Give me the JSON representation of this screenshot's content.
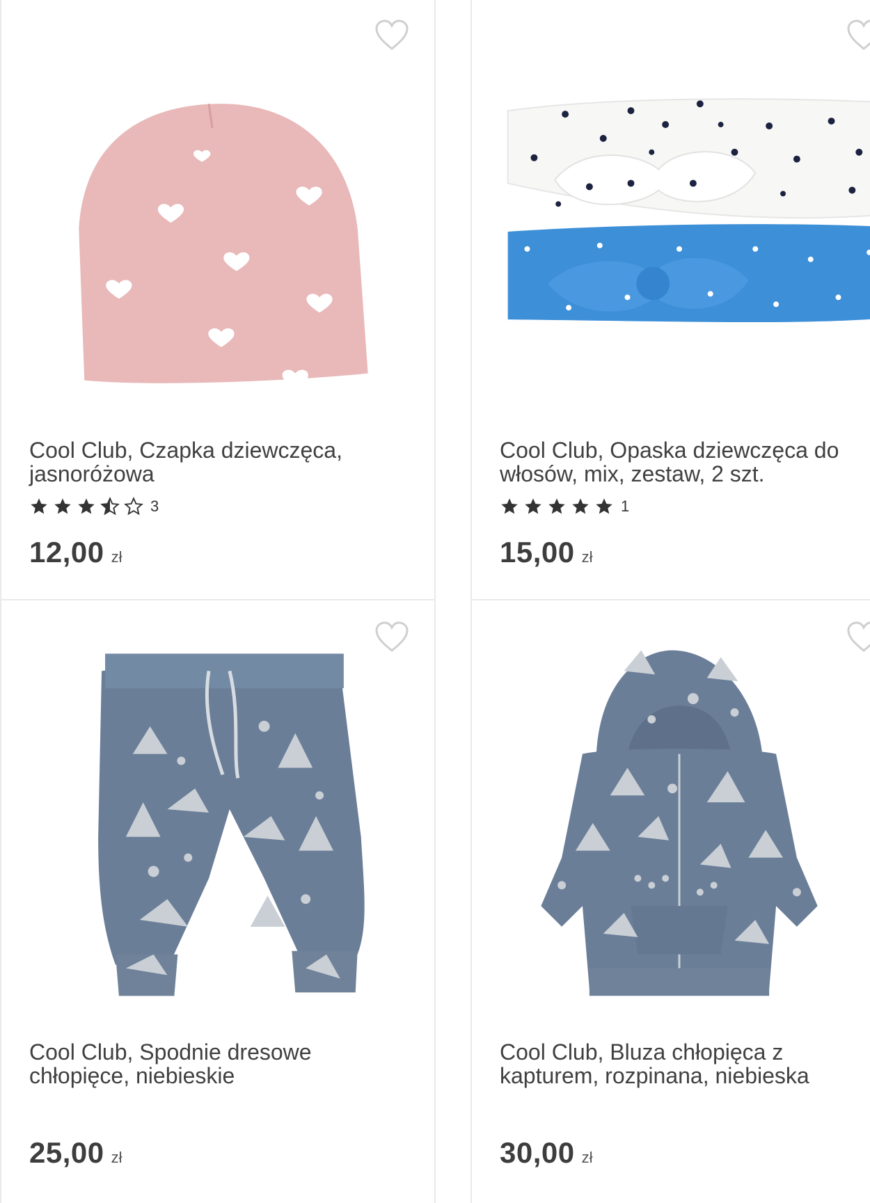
{
  "products": [
    {
      "title": "Cool Club, Czapka dziewczęca, jasnoróżowa",
      "title_line1": "Cool Club, Czapka dziewczęca,",
      "title_line2": "jasnoróżowa",
      "rating": 3.5,
      "rating_count": "3",
      "price": "12,00",
      "currency": "zł",
      "image": "pink-hat-with-hearts",
      "wishlist_icon": "heart-outline-icon"
    },
    {
      "title": "Cool Club, Opaska dziewczęca do włosów, mix, zestaw, 2 szt.",
      "title_line1": "Cool Club, Opaska dziewczęca do",
      "title_line2": "włosów, mix, zestaw, 2 szt.",
      "rating": 5,
      "rating_count": "1",
      "price": "15,00",
      "currency": "zł",
      "image": "two-headbands-white-blue",
      "wishlist_icon": "heart-outline-icon"
    },
    {
      "title": "Cool Club, Spodnie dresowe chłopięce, niebieskie",
      "title_line1": "Cool Club, Spodnie dresowe",
      "title_line2": "chłopięce, niebieskie",
      "price": "25,00",
      "currency": "zł",
      "image": "blue-sweatpants-winter-print",
      "wishlist_icon": "heart-outline-icon"
    },
    {
      "title": "Cool Club, Bluza chłopięca z kapturem, rozpinana, niebieska",
      "title_line1": "Cool Club, Bluza chłopięca z",
      "title_line2": "kapturem, rozpinana, niebieska",
      "price": "30,00",
      "currency": "zł",
      "image": "blue-zip-hoodie-winter-print",
      "wishlist_icon": "heart-outline-icon"
    }
  ],
  "colors": {
    "hat_pink": "#e9b8b8",
    "band_white": "#f7f7f5",
    "band_blue": "#3d8fd8",
    "garment_blue": "#6b7e98",
    "print_grey": "#c9cfd5",
    "star": "#333333",
    "border": "#e9e9e9"
  }
}
